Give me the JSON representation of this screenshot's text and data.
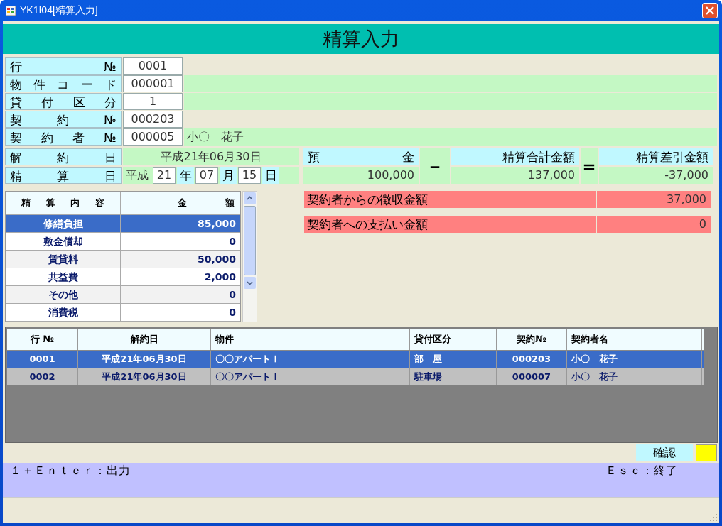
{
  "window": {
    "title": "YK1I04[精算入力]"
  },
  "header": {
    "title": "精算入力"
  },
  "fields": [
    {
      "label": "行 №",
      "value": "0001",
      "kind": "plain"
    },
    {
      "label": "物 件 コ ー ド",
      "value": "000001",
      "kind": "with_detail"
    },
    {
      "label": "貸 付 区 分",
      "value": "1",
      "kind": "with_detail"
    },
    {
      "label": "契 約 №",
      "value": "000203",
      "kind": "plain"
    },
    {
      "label": "契 約 者 №",
      "value": "000005",
      "kind": "with_detail",
      "detail": "小〇　花子"
    }
  ],
  "cancel_date": {
    "label": "解 約 日",
    "value": "平成21年06月30日"
  },
  "settle_date": {
    "label": "精 算 日",
    "era": "平成",
    "year": "21",
    "year_unit": "年",
    "month": "07",
    "month_unit": "月",
    "day": "15",
    "day_unit": "日"
  },
  "balance": {
    "deposit_label": "預 金",
    "deposit": "100,000",
    "minus": "－",
    "total_label": "精算合計金額",
    "total": "137,000",
    "equals": "＝",
    "diff_label": "精算差引金額",
    "diff": "-37,000"
  },
  "results": [
    {
      "label": "契約者からの徴収金額",
      "value": "37,000"
    },
    {
      "label": "契約者への支払い金額",
      "value": "0"
    }
  ],
  "breakdown": {
    "columns": [
      "精 算 内 容",
      "金 額"
    ],
    "rows": [
      {
        "item": "修繕負担",
        "amount": "85,000",
        "selected": true
      },
      {
        "item": "敷金償却",
        "amount": "0",
        "selected": false
      },
      {
        "item": "賃貸料",
        "amount": "50,000",
        "selected": false
      },
      {
        "item": "共益費",
        "amount": "2,000",
        "selected": false
      },
      {
        "item": "その他",
        "amount": "0",
        "selected": false
      },
      {
        "item": "消費税",
        "amount": "0",
        "selected": false
      }
    ]
  },
  "list": {
    "columns": [
      "行 №",
      "解約日",
      "物件",
      "貸付区分",
      "契約№",
      "契約者名"
    ],
    "rows": [
      {
        "cells": [
          "0001",
          "平成21年06月30日",
          "〇〇アパートＩ",
          "部　屋",
          "000203",
          "小〇　花子"
        ],
        "selected": true
      },
      {
        "cells": [
          "0002",
          "平成21年06月30日",
          "〇〇アパートＩ",
          "駐車場",
          "000007",
          "小〇　花子"
        ],
        "selected": false
      }
    ]
  },
  "confirm": {
    "label": "確認"
  },
  "status_bar": {
    "left": "１＋Ｅｎｔｅｒ：出力",
    "right": "Ｅｓｃ：終了"
  }
}
